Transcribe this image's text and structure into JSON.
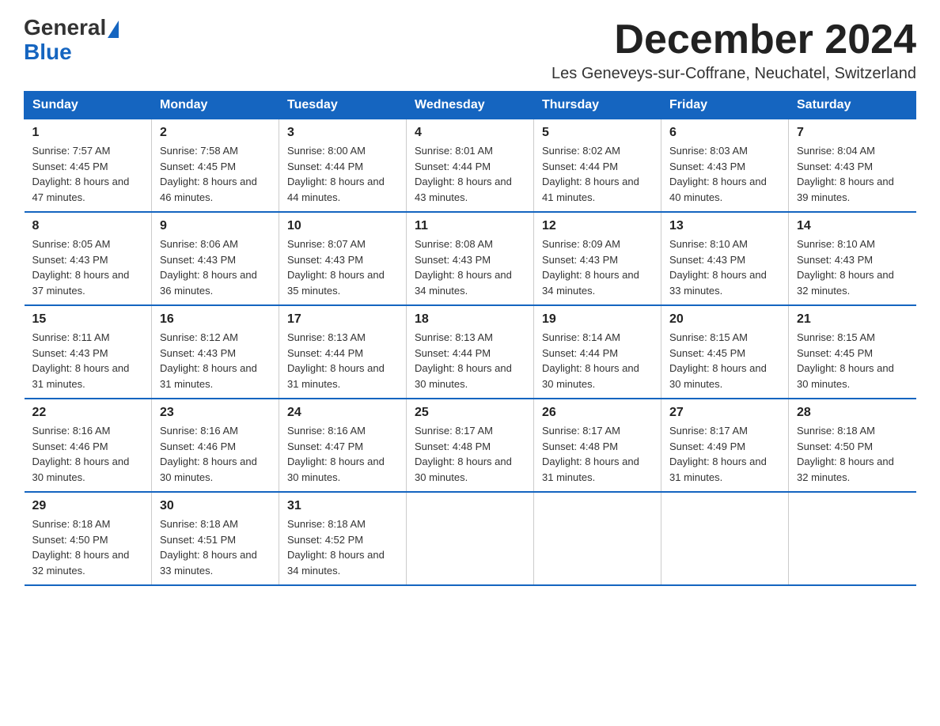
{
  "header": {
    "logo_general": "General",
    "logo_blue": "Blue",
    "title": "December 2024",
    "subtitle": "Les Geneveys-sur-Coffrane, Neuchatel, Switzerland"
  },
  "days_of_week": [
    "Sunday",
    "Monday",
    "Tuesday",
    "Wednesday",
    "Thursday",
    "Friday",
    "Saturday"
  ],
  "weeks": [
    [
      {
        "day": "1",
        "sunrise": "7:57 AM",
        "sunset": "4:45 PM",
        "daylight": "8 hours and 47 minutes."
      },
      {
        "day": "2",
        "sunrise": "7:58 AM",
        "sunset": "4:45 PM",
        "daylight": "8 hours and 46 minutes."
      },
      {
        "day": "3",
        "sunrise": "8:00 AM",
        "sunset": "4:44 PM",
        "daylight": "8 hours and 44 minutes."
      },
      {
        "day": "4",
        "sunrise": "8:01 AM",
        "sunset": "4:44 PM",
        "daylight": "8 hours and 43 minutes."
      },
      {
        "day": "5",
        "sunrise": "8:02 AM",
        "sunset": "4:44 PM",
        "daylight": "8 hours and 41 minutes."
      },
      {
        "day": "6",
        "sunrise": "8:03 AM",
        "sunset": "4:43 PM",
        "daylight": "8 hours and 40 minutes."
      },
      {
        "day": "7",
        "sunrise": "8:04 AM",
        "sunset": "4:43 PM",
        "daylight": "8 hours and 39 minutes."
      }
    ],
    [
      {
        "day": "8",
        "sunrise": "8:05 AM",
        "sunset": "4:43 PM",
        "daylight": "8 hours and 37 minutes."
      },
      {
        "day": "9",
        "sunrise": "8:06 AM",
        "sunset": "4:43 PM",
        "daylight": "8 hours and 36 minutes."
      },
      {
        "day": "10",
        "sunrise": "8:07 AM",
        "sunset": "4:43 PM",
        "daylight": "8 hours and 35 minutes."
      },
      {
        "day": "11",
        "sunrise": "8:08 AM",
        "sunset": "4:43 PM",
        "daylight": "8 hours and 34 minutes."
      },
      {
        "day": "12",
        "sunrise": "8:09 AM",
        "sunset": "4:43 PM",
        "daylight": "8 hours and 34 minutes."
      },
      {
        "day": "13",
        "sunrise": "8:10 AM",
        "sunset": "4:43 PM",
        "daylight": "8 hours and 33 minutes."
      },
      {
        "day": "14",
        "sunrise": "8:10 AM",
        "sunset": "4:43 PM",
        "daylight": "8 hours and 32 minutes."
      }
    ],
    [
      {
        "day": "15",
        "sunrise": "8:11 AM",
        "sunset": "4:43 PM",
        "daylight": "8 hours and 31 minutes."
      },
      {
        "day": "16",
        "sunrise": "8:12 AM",
        "sunset": "4:43 PM",
        "daylight": "8 hours and 31 minutes."
      },
      {
        "day": "17",
        "sunrise": "8:13 AM",
        "sunset": "4:44 PM",
        "daylight": "8 hours and 31 minutes."
      },
      {
        "day": "18",
        "sunrise": "8:13 AM",
        "sunset": "4:44 PM",
        "daylight": "8 hours and 30 minutes."
      },
      {
        "day": "19",
        "sunrise": "8:14 AM",
        "sunset": "4:44 PM",
        "daylight": "8 hours and 30 minutes."
      },
      {
        "day": "20",
        "sunrise": "8:15 AM",
        "sunset": "4:45 PM",
        "daylight": "8 hours and 30 minutes."
      },
      {
        "day": "21",
        "sunrise": "8:15 AM",
        "sunset": "4:45 PM",
        "daylight": "8 hours and 30 minutes."
      }
    ],
    [
      {
        "day": "22",
        "sunrise": "8:16 AM",
        "sunset": "4:46 PM",
        "daylight": "8 hours and 30 minutes."
      },
      {
        "day": "23",
        "sunrise": "8:16 AM",
        "sunset": "4:46 PM",
        "daylight": "8 hours and 30 minutes."
      },
      {
        "day": "24",
        "sunrise": "8:16 AM",
        "sunset": "4:47 PM",
        "daylight": "8 hours and 30 minutes."
      },
      {
        "day": "25",
        "sunrise": "8:17 AM",
        "sunset": "4:48 PM",
        "daylight": "8 hours and 30 minutes."
      },
      {
        "day": "26",
        "sunrise": "8:17 AM",
        "sunset": "4:48 PM",
        "daylight": "8 hours and 31 minutes."
      },
      {
        "day": "27",
        "sunrise": "8:17 AM",
        "sunset": "4:49 PM",
        "daylight": "8 hours and 31 minutes."
      },
      {
        "day": "28",
        "sunrise": "8:18 AM",
        "sunset": "4:50 PM",
        "daylight": "8 hours and 32 minutes."
      }
    ],
    [
      {
        "day": "29",
        "sunrise": "8:18 AM",
        "sunset": "4:50 PM",
        "daylight": "8 hours and 32 minutes."
      },
      {
        "day": "30",
        "sunrise": "8:18 AM",
        "sunset": "4:51 PM",
        "daylight": "8 hours and 33 minutes."
      },
      {
        "day": "31",
        "sunrise": "8:18 AM",
        "sunset": "4:52 PM",
        "daylight": "8 hours and 34 minutes."
      },
      null,
      null,
      null,
      null
    ]
  ]
}
